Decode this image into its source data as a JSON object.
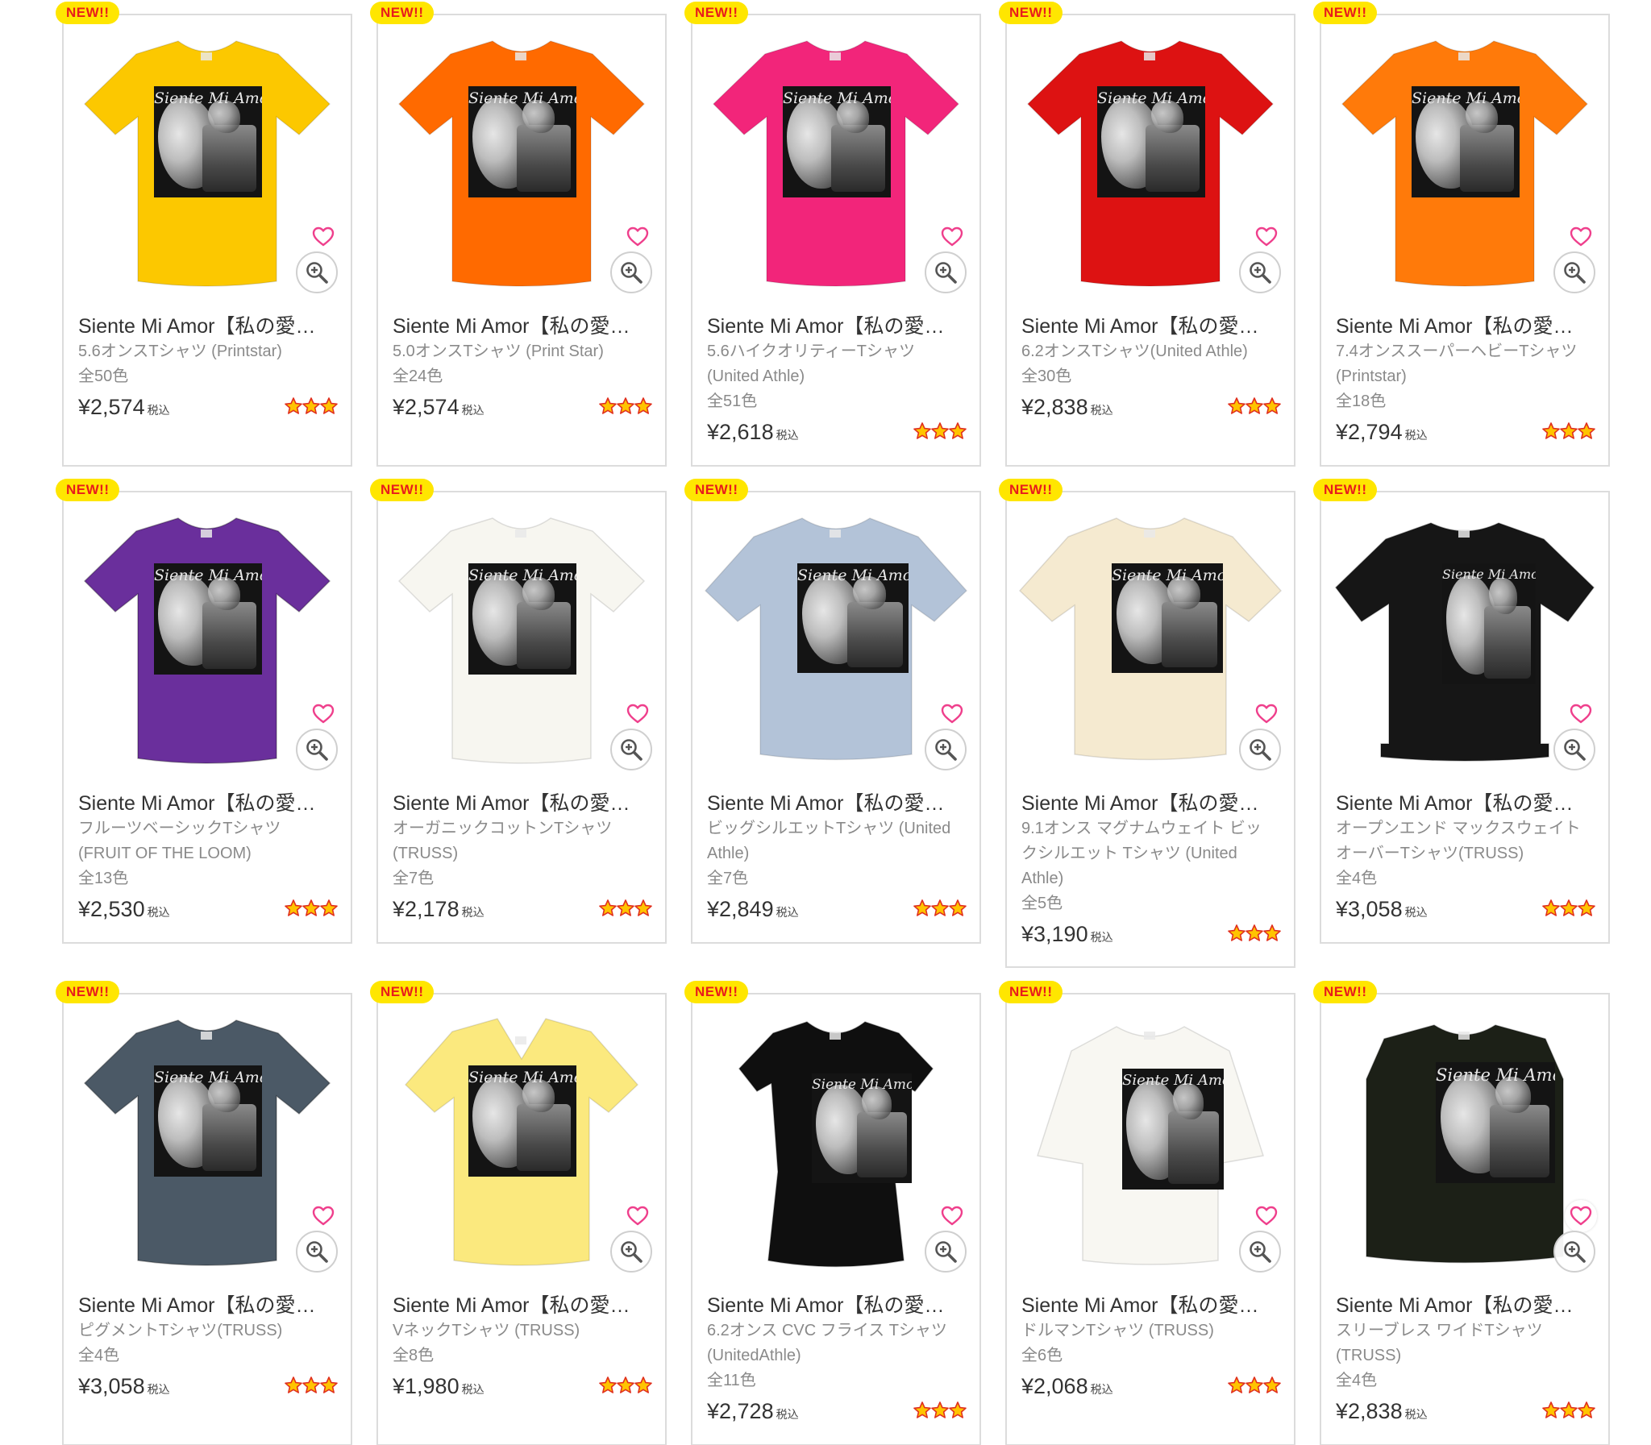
{
  "badge_label": "NEW!!",
  "tax_label": "税込",
  "products": [
    {
      "title": "Siente Mi Amor【私の愛…",
      "sub": "5.6オンスTシャツ (Printstar)",
      "colors": "全50色",
      "price": "¥2,574",
      "shirt_color": "#fcc800"
    },
    {
      "title": "Siente Mi Amor【私の愛…",
      "sub": "5.0オンスTシャツ (Print Star)",
      "colors": "全24色",
      "price": "¥2,574",
      "shirt_color": "#ff6a00"
    },
    {
      "title": "Siente Mi Amor【私の愛…",
      "sub": "5.6ハイクオリティーTシャツ (United Athle)",
      "colors": "全51色",
      "price": "¥2,618",
      "shirt_color": "#f2257a"
    },
    {
      "title": "Siente Mi Amor【私の愛…",
      "sub": "6.2オンスTシャツ(United Athle)",
      "colors": "全30色",
      "price": "¥2,838",
      "shirt_color": "#dd1212"
    },
    {
      "title": "Siente Mi Amor【私の愛…",
      "sub": "7.4オンススーパーヘビーTシャツ (Printstar)",
      "colors": "全18色",
      "price": "¥2,794",
      "shirt_color": "#ff7a0a"
    },
    {
      "title": "Siente Mi Amor【私の愛…",
      "sub": "フルーツベーシックTシャツ (FRUIT OF THE LOOM)",
      "colors": "全13色",
      "price": "¥2,530",
      "shirt_color": "#6a2f9c"
    },
    {
      "title": "Siente Mi Amor【私の愛…",
      "sub": "オーガニックコットンTシャツ (TRUSS)",
      "colors": "全7色",
      "price": "¥2,178",
      "shirt_color": "#f7f6f0"
    },
    {
      "title": "Siente Mi Amor【私の愛…",
      "sub": "ビッグシルエットTシャツ (United Athle)",
      "colors": "全7色",
      "price": "¥2,849",
      "shirt_color": "#b3c3d8"
    },
    {
      "title": "Siente Mi Amor【私の愛…",
      "sub": "9.1オンス マグナムウェイト ビッグシルエット Tシャツ (United Athle)",
      "colors": "全5色",
      "price": "¥3,190",
      "shirt_color": "#f5ead0"
    },
    {
      "title": "Siente Mi Amor【私の愛…",
      "sub": "オープンエンド マックスウェイト オーバーTシャツ(TRUSS)",
      "colors": "全4色",
      "price": "¥3,058",
      "shirt_color": "#161616"
    },
    {
      "title": "Siente Mi Amor【私の愛…",
      "sub": "ピグメントTシャツ(TRUSS)",
      "colors": "全4色",
      "price": "¥3,058",
      "shirt_color": "#4b5966"
    },
    {
      "title": "Siente Mi Amor【私の愛…",
      "sub": "VネックTシャツ (TRUSS)",
      "colors": "全8色",
      "price": "¥1,980",
      "shirt_color": "#fbe97e"
    },
    {
      "title": "Siente Mi Amor【私の愛…",
      "sub": "6.2オンス CVC フライス Tシャツ (UnitedAthle)",
      "colors": "全11色",
      "price": "¥2,728",
      "shirt_color": "#0f0f0f"
    },
    {
      "title": "Siente Mi Amor【私の愛…",
      "sub": "ドルマンTシャツ (TRUSS)",
      "colors": "全6色",
      "price": "¥2,068",
      "shirt_color": "#f8f7f2"
    },
    {
      "title": "Siente Mi Amor【私の愛…",
      "sub": "スリーブレス ワイドTシャツ (TRUSS)",
      "colors": "全4色",
      "price": "¥2,838",
      "shirt_color": "#1c2017"
    }
  ]
}
